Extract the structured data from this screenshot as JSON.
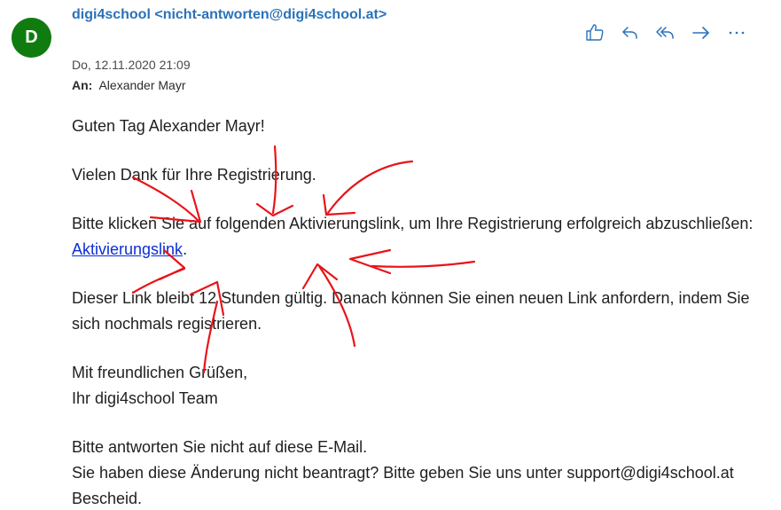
{
  "sender": {
    "initial": "D",
    "display": "digi4school <nicht-antworten@digi4school.at>",
    "avatar_color": "#107c10",
    "name_color": "#2a72b9"
  },
  "meta": {
    "date": "Do, 12.11.2020 21:09",
    "to_label": "An:",
    "to_name": "Alexander Mayr"
  },
  "actions": [
    {
      "name": "like-icon"
    },
    {
      "name": "reply-icon"
    },
    {
      "name": "reply-all-icon"
    },
    {
      "name": "forward-icon"
    },
    {
      "name": "more-icon"
    }
  ],
  "message": {
    "greeting": "Guten Tag Alexander Mayr!",
    "thanks": "Vielen Dank für Ihre Registrierung.",
    "click_before": "Bitte klicken Sie auf folgenden Aktivierungslink, um Ihre Registrierung erfolgreich abzuschließen: ",
    "link_text": "Aktivierungslink",
    "click_after": ".",
    "validity": "Dieser Link bleibt 12 Stunden gültig. Danach können Sie einen neuen Link anfordern, indem Sie sich nochmals registrieren.",
    "closing_1": "Mit freundlichen Grüßen,",
    "closing_2": "Ihr digi4school Team",
    "footer_1": "Bitte antworten Sie nicht auf diese E-Mail.",
    "footer_2": "Sie haben diese Änderung nicht beantragt? Bitte geben Sie uns unter support@digi4school.at Bescheid."
  },
  "annotation_color": "#e8141a",
  "link_color": "#0b2fd6"
}
